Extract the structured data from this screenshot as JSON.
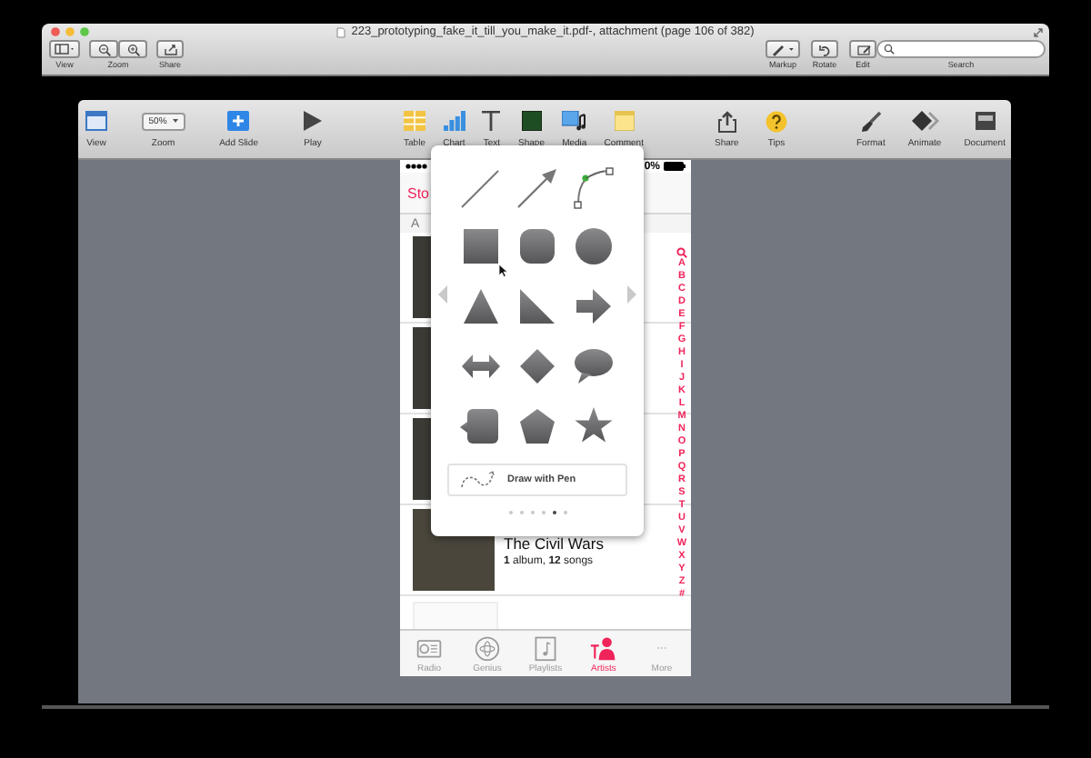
{
  "preview_window": {
    "title": "223_prototyping_fake_it_till_you_make_it.pdf-, attachment (page 106 of 382)",
    "toolbar_left": [
      {
        "kind": "view",
        "label": "View"
      },
      {
        "kind": "zoom",
        "label": "Zoom"
      },
      {
        "kind": "share",
        "label": "Share"
      }
    ],
    "toolbar_right": [
      {
        "kind": "markup",
        "label": "Markup"
      },
      {
        "kind": "rotate",
        "label": "Rotate"
      },
      {
        "kind": "edit",
        "label": "Edit"
      }
    ],
    "search": {
      "label": "Search"
    }
  },
  "keynote_toolbar": {
    "groups": [
      [
        {
          "kind": "view",
          "label": "View"
        },
        {
          "kind": "zoom",
          "label": "Zoom",
          "value": "50%"
        },
        {
          "kind": "add-slide",
          "label": "Add Slide"
        }
      ],
      [
        {
          "kind": "play",
          "label": "Play"
        }
      ],
      [
        {
          "kind": "table",
          "label": "Table"
        },
        {
          "kind": "chart",
          "label": "Chart"
        },
        {
          "kind": "text",
          "label": "Text"
        },
        {
          "kind": "shape",
          "label": "Shape"
        },
        {
          "kind": "media",
          "label": "Media"
        },
        {
          "kind": "comment",
          "label": "Comment"
        }
      ],
      [
        {
          "kind": "share",
          "label": "Share"
        },
        {
          "kind": "tips",
          "label": "Tips"
        }
      ],
      [
        {
          "kind": "format",
          "label": "Format"
        },
        {
          "kind": "animate",
          "label": "Animate"
        },
        {
          "kind": "document",
          "label": "Document"
        }
      ]
    ]
  },
  "phone": {
    "battery_text": "0%",
    "back_label": "Sto",
    "section": "A",
    "rows": [
      {
        "kind": "covered"
      },
      {
        "kind": "covered"
      },
      {
        "kind": "covered"
      },
      {
        "kind": "artist",
        "title": "The Civil Wars",
        "subtitle": "**1** album, **12** songs"
      },
      {
        "kind": "partial"
      }
    ],
    "index": [
      "A",
      "B",
      "C",
      "D",
      "E",
      "F",
      "G",
      "H",
      "I",
      "J",
      "K",
      "L",
      "M",
      "N",
      "O",
      "P",
      "Q",
      "R",
      "S",
      "T",
      "U",
      "V",
      "W",
      "X",
      "Y",
      "Z",
      "#"
    ],
    "tabs": [
      {
        "kind": "radio",
        "label": "Radio",
        "selected": false
      },
      {
        "kind": "genius",
        "label": "Genius",
        "selected": false
      },
      {
        "kind": "playlists",
        "label": "Playlists",
        "selected": false
      },
      {
        "kind": "artists",
        "label": "Artists",
        "selected": true
      },
      {
        "kind": "more",
        "label": "More",
        "selected": false
      }
    ]
  },
  "shape_popup": {
    "shapes": [
      {
        "kind": "line"
      },
      {
        "kind": "arrow"
      },
      {
        "kind": "curve"
      },
      {
        "kind": "square"
      },
      {
        "kind": "rounded-square"
      },
      {
        "kind": "circle"
      },
      {
        "kind": "triangle"
      },
      {
        "kind": "right-triangle"
      },
      {
        "kind": "arrow-right"
      },
      {
        "kind": "double-arrow"
      },
      {
        "kind": "diamond"
      },
      {
        "kind": "speech-bubble"
      },
      {
        "kind": "callout"
      },
      {
        "kind": "pentagon"
      },
      {
        "kind": "star"
      }
    ],
    "pen_button": "Draw with Pen",
    "pages": [
      {
        "selected": false
      },
      {
        "selected": false
      },
      {
        "selected": false
      },
      {
        "selected": false
      },
      {
        "selected": true
      },
      {
        "selected": false
      }
    ]
  }
}
